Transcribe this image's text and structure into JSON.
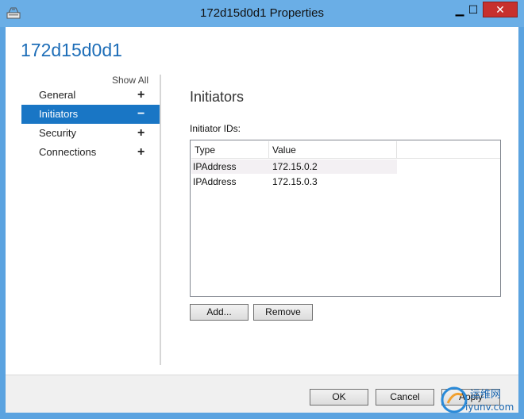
{
  "window": {
    "title": "172d15d0d1 Properties",
    "controls": {
      "minimize": "▁",
      "maximize": "☐",
      "close": "✕"
    }
  },
  "page_title": "172d15d0d1",
  "nav": {
    "show_all": "Show All",
    "items": [
      {
        "label": "General",
        "sign": "+"
      },
      {
        "label": "Initiators",
        "sign": "−"
      },
      {
        "label": "Security",
        "sign": "+"
      },
      {
        "label": "Connections",
        "sign": "+"
      }
    ]
  },
  "section": {
    "title": "Initiators",
    "ids_label": "Initiator IDs:"
  },
  "list": {
    "columns": [
      "Type",
      "Value"
    ],
    "rows": [
      {
        "type": "IPAddress",
        "value": "172.15.0.2"
      },
      {
        "type": "IPAddress",
        "value": "172.15.0.3"
      }
    ]
  },
  "buttons": {
    "add": "Add...",
    "remove": "Remove",
    "ok": "OK",
    "cancel": "Cancel",
    "apply": "Apply"
  },
  "watermark": {
    "cn": "运维网",
    "site": "iyunv.com"
  },
  "colors": {
    "accent": "#1976c5",
    "title_text": "#1e6eb8",
    "close_button": "#c7302d"
  }
}
